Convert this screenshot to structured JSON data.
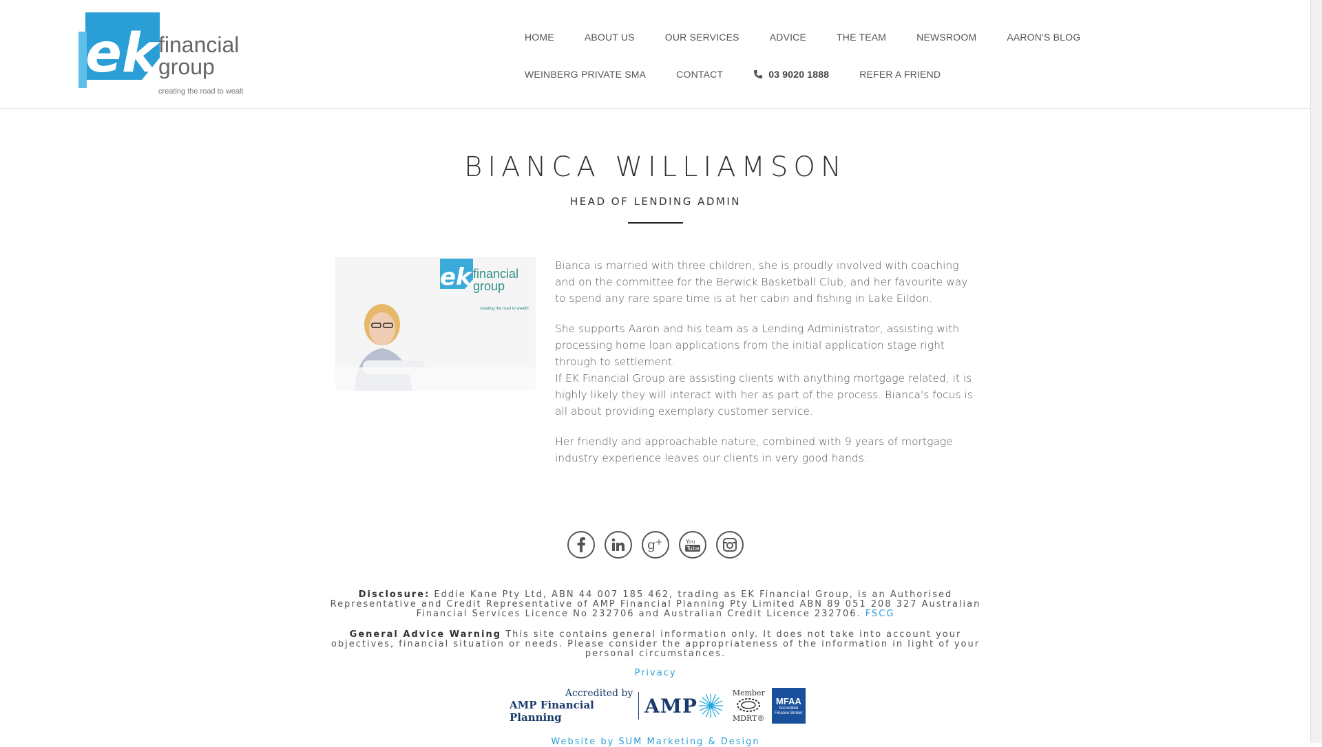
{
  "header": {
    "logo": {
      "brand": "ek",
      "name_line1": "financial",
      "name_line2": "group",
      "tagline": "creating the road to wealth"
    },
    "nav_row1": [
      "HOME",
      "ABOUT US",
      "OUR SERVICES",
      "ADVICE",
      "THE TEAM",
      "NEWSROOM",
      "AARON'S BLOG"
    ],
    "nav_row2": [
      "WEINBERG PRIVATE SMA",
      "CONTACT",
      "03 9020 1888",
      "REFER A FRIEND"
    ]
  },
  "profile": {
    "name": "BIANCA WILLIAMSON",
    "role": "HEAD OF LENDING ADMIN",
    "photo_logo": {
      "brand": "ek",
      "name_line1": "financial",
      "name_line2": "group",
      "tagline": "creating the road to wealth"
    },
    "bio": [
      "Bianca is married with three children, she is proudly involved with coaching and on the committee for the Berwick Basketball Club, and her favourite way to spend any rare spare time is at her cabin and fishing in Lake Eildon.",
      "She supports Aaron and his team as a Lending Administrator, assisting with processing home loan applications from the initial application stage right through to settlement.",
      "If EK Financial Group are assisting clients with anything mortgage related, it is highly likely they will interact with her as part of the process. Bianca's focus is all about providing exemplary customer service.",
      "Her friendly and approachable nature, combined with 9 years of mortgage industry experience leaves our clients in very good hands."
    ]
  },
  "social": [
    "facebook-icon",
    "linkedin-icon",
    "google-plus-icon",
    "youtube-icon",
    "instagram-icon"
  ],
  "footer": {
    "disclosure_label": "Disclosure:",
    "disclosure_text": "Eddie Kane Pty Ltd, ABN 44 007 185 462, trading as EK Financial Group, is an Authorised Representative and Credit Representative of AMP Financial Planning Pty Limited ABN 89 051 208 327 Australian Financial Services Licence No 232706 and Australian Credit Licence 232706.",
    "disclosure_link": "FSCG",
    "warning_label": "General Advice Warning",
    "warning_text": "This site contains general information only. It does not take into account your objectives, financial situation or needs. Please consider the appropriateness of the information in light of your personal circumstances.",
    "privacy": "Privacy",
    "accred_line1": "Accredited by",
    "accred_line2": "AMP Financial Planning",
    "amp": "AMP",
    "mdrt_line1": "Member",
    "mdrt_line2": "MDRT®",
    "mfaa": "MFAA",
    "mfaa_sub": "Accredited Finance Broker",
    "website_by": "Website by SUM Marketing & Design"
  },
  "colors": {
    "brand_blue": "#2a9fd6",
    "text": "#555555",
    "dark_navy": "#1a3a6b"
  }
}
